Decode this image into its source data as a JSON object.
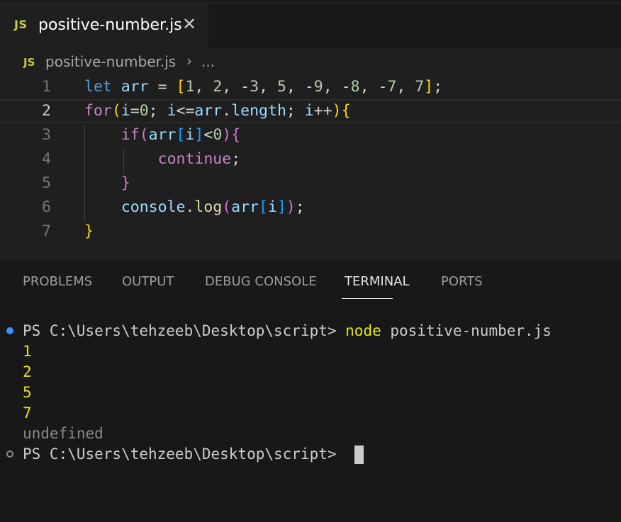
{
  "tab": {
    "icon": "JS",
    "filename": "positive-number.js",
    "close": "✕"
  },
  "breadcrumb": {
    "icon": "JS",
    "file": "positive-number.js",
    "separator": "›",
    "more": "..."
  },
  "editor": {
    "line_numbers": [
      "1",
      "2",
      "3",
      "4",
      "5",
      "6",
      "7"
    ],
    "current_line": 2,
    "lines": [
      "let arr = [1, 2, -3, 5, -9, -8, -7, 7];",
      "for(i=0; i<=arr.length; i++){",
      "    if(arr[i]<0){",
      "        continue;",
      "    }",
      "    console.log(arr[i]);",
      "}"
    ]
  },
  "panel": {
    "tabs": [
      "PROBLEMS",
      "OUTPUT",
      "DEBUG CONSOLE",
      "TERMINAL",
      "PORTS"
    ],
    "active_tab": "TERMINAL"
  },
  "terminal": {
    "prompt": "PS C:\\Users\\tehzeeb\\Desktop\\script> ",
    "command_name": "node",
    "command_args": " positive-number.js",
    "output": [
      "1",
      "2",
      "5",
      "7"
    ],
    "result": "undefined",
    "prompt2": "PS C:\\Users\\tehzeeb\\Desktop\\script> "
  },
  "colors": {
    "editor_bg": "#1f1f1f",
    "panel_bg": "#181818",
    "keyword": "#569cd6",
    "control": "#c586c0",
    "variable": "#9cdcfe",
    "number": "#b5cea8",
    "function": "#dcdcaa",
    "terminal_yellow": "#e5e510",
    "status_dot": "#3794ff"
  }
}
